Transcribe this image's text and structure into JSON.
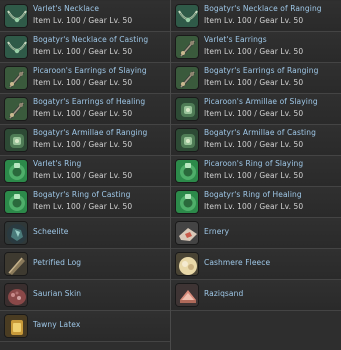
{
  "level_text": "Item Lv. 100 / Gear Lv. 50",
  "items": [
    {
      "name": "Varlet's Necklace",
      "level": "Item Lv. 100 / Gear Lv. 50",
      "icon": "necklace-icon"
    },
    {
      "name": "Bogatyr's Necklace of Ranging",
      "level": "Item Lv. 100 / Gear Lv. 50",
      "icon": "necklace-icon"
    },
    {
      "name": "Bogatyr's Necklace of Casting",
      "level": "Item Lv. 100 / Gear Lv. 50",
      "icon": "necklace-icon"
    },
    {
      "name": "Varlet's Earrings",
      "level": "Item Lv. 100 / Gear Lv. 50",
      "icon": "earrings-icon"
    },
    {
      "name": "Picaroon's Earrings of Slaying",
      "level": "Item Lv. 100 / Gear Lv. 50",
      "icon": "earrings-icon"
    },
    {
      "name": "Bogatyr's Earrings of Ranging",
      "level": "Item Lv. 100 / Gear Lv. 50",
      "icon": "earrings-icon"
    },
    {
      "name": "Bogatyr's Earrings of Healing",
      "level": "Item Lv. 100 / Gear Lv. 50",
      "icon": "earrings-icon"
    },
    {
      "name": "Picaroon's Armillae of Slaying",
      "level": "Item Lv. 100 / Gear Lv. 50",
      "icon": "armillae-icon"
    },
    {
      "name": "Bogatyr's Armillae of Ranging",
      "level": "Item Lv. 100 / Gear Lv. 50",
      "icon": "armillae-icon"
    },
    {
      "name": "Bogatyr's Armillae of Casting",
      "level": "Item Lv. 100 / Gear Lv. 50",
      "icon": "armillae-icon"
    },
    {
      "name": "Varlet's Ring",
      "level": "Item Lv. 100 / Gear Lv. 50",
      "icon": "ring-icon"
    },
    {
      "name": "Picaroon's Ring of Slaying",
      "level": "Item Lv. 100 / Gear Lv. 50",
      "icon": "ring-icon"
    },
    {
      "name": "Bogatyr's Ring of Casting",
      "level": "Item Lv. 100 / Gear Lv. 50",
      "icon": "ring-icon"
    },
    {
      "name": "Bogatyr's Ring of Healing",
      "level": "Item Lv. 100 / Gear Lv. 50",
      "icon": "ring-icon"
    },
    {
      "name": "Scheelite",
      "level": "",
      "icon": "scheelite-icon"
    },
    {
      "name": "Ernery",
      "level": "",
      "icon": "ernery-icon"
    },
    {
      "name": "Petrified Log",
      "level": "",
      "icon": "log-icon"
    },
    {
      "name": "Cashmere Fleece",
      "level": "",
      "icon": "fleece-icon"
    },
    {
      "name": "Saurian Skin",
      "level": "",
      "icon": "skin-icon"
    },
    {
      "name": "Raziqsand",
      "level": "",
      "icon": "sand-icon"
    },
    {
      "name": "Tawny Latex",
      "level": "",
      "icon": "latex-icon"
    }
  ],
  "colors": {
    "background": "#2e2e2e",
    "name_text": "#9fc8e8",
    "level_text": "#d2d2d2",
    "row_border": "#444444",
    "necklace_bg": "#2f5a48",
    "ring_bg": "#2c8a4a"
  }
}
